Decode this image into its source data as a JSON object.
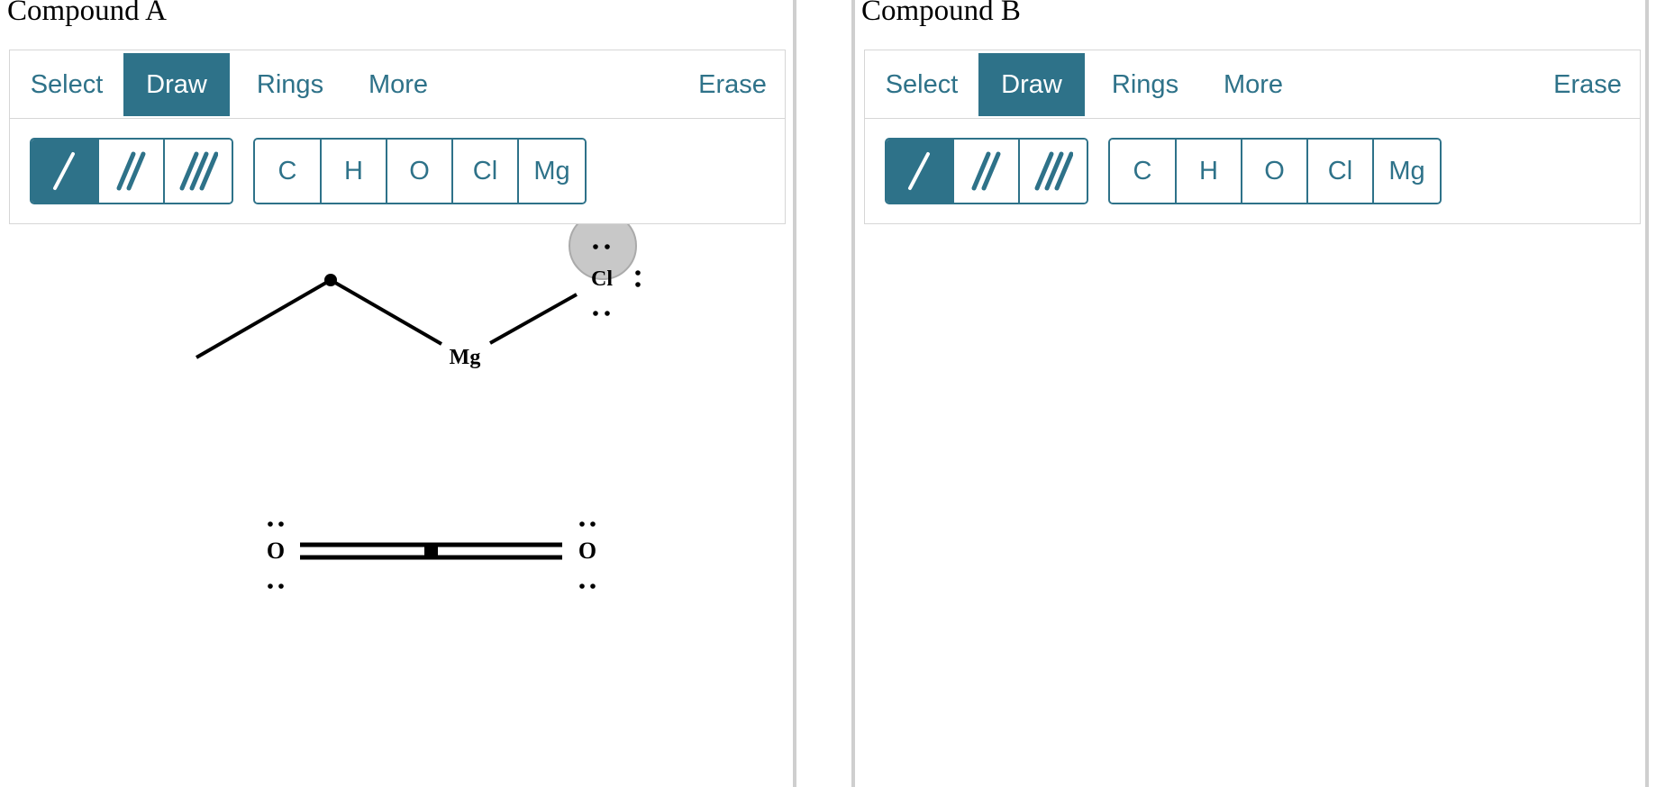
{
  "panels": [
    {
      "title": "Compound A",
      "tabs": [
        {
          "label": "Select",
          "active": false
        },
        {
          "label": "Draw",
          "active": true
        },
        {
          "label": "Rings",
          "active": false
        },
        {
          "label": "More",
          "active": false
        }
      ],
      "erase_label": "Erase",
      "bond_tools": [
        {
          "icon": "single-bond-icon",
          "active": true
        },
        {
          "icon": "double-bond-icon",
          "active": false
        },
        {
          "icon": "triple-bond-icon",
          "active": false
        }
      ],
      "elements": [
        "C",
        "H",
        "O",
        "Cl",
        "Mg"
      ],
      "molecules": {
        "grignard": {
          "mg_label": "Mg",
          "cl_label": "Cl"
        },
        "co2": {
          "left_o": "O",
          "right_o": "O"
        }
      }
    },
    {
      "title": "Compound B",
      "tabs": [
        {
          "label": "Select",
          "active": false
        },
        {
          "label": "Draw",
          "active": true
        },
        {
          "label": "Rings",
          "active": false
        },
        {
          "label": "More",
          "active": false
        }
      ],
      "erase_label": "Erase",
      "bond_tools": [
        {
          "icon": "single-bond-icon",
          "active": true
        },
        {
          "icon": "double-bond-icon",
          "active": false
        },
        {
          "icon": "triple-bond-icon",
          "active": false
        }
      ],
      "elements": [
        "C",
        "H",
        "O",
        "Cl",
        "Mg"
      ]
    }
  ],
  "colors": {
    "accent": "#2e7289",
    "border": "#d6d6d6",
    "divider": "#cfcfcf",
    "hover": "#c8c8c8"
  }
}
